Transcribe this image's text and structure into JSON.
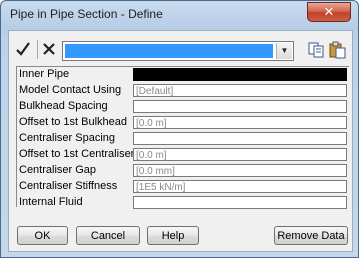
{
  "window": {
    "title": "Pipe in Pipe Section - Define",
    "close_label": "✕"
  },
  "toolbar": {
    "accept_icon": "check-icon",
    "cancel_icon": "x-icon",
    "combo_value": "",
    "copy_icon": "copy-icon",
    "paste_icon": "paste-icon"
  },
  "fields": [
    {
      "label": "Inner Pipe",
      "value": ""
    },
    {
      "label": "Model Contact Using",
      "value": "[Default]"
    },
    {
      "label": "Bulkhead Spacing",
      "value": ""
    },
    {
      "label": "Offset to 1st Bulkhead",
      "value": "[0.0 m]"
    },
    {
      "label": "Centraliser Spacing",
      "value": ""
    },
    {
      "label": "Offset to 1st Centraliser",
      "value": "[0.0 m]"
    },
    {
      "label": "Centraliser Gap",
      "value": "[0.0 mm]"
    },
    {
      "label": "Centraliser Stiffness",
      "value": "[1E5 kN/m]"
    },
    {
      "label": "Internal Fluid",
      "value": ""
    }
  ],
  "buttons": {
    "ok": "OK",
    "cancel": "Cancel",
    "help": "Help",
    "remove": "Remove Data"
  },
  "colors": {
    "selection": "#3399ff",
    "inner_pipe_fill": "#000000"
  }
}
